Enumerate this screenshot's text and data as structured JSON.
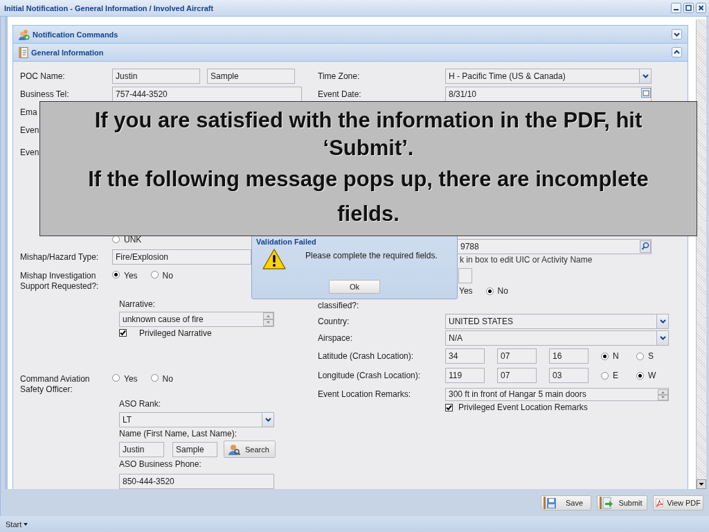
{
  "window": {
    "title": "Initial Notification - General Information / Involved Aircraft"
  },
  "sections": [
    {
      "title": "Notification Commands",
      "expanded": false
    },
    {
      "title": "General Information",
      "expanded": true
    }
  ],
  "poc": {
    "label": "POC Name:",
    "first": "Justin",
    "last": "Sample"
  },
  "business_tel": {
    "label": "Business Tel:",
    "value": "757-444-3520"
  },
  "cut_labels": [
    "Ema",
    "Even",
    "Even"
  ],
  "unk_option": {
    "label": "UNK",
    "selected": false
  },
  "hazard_type": {
    "label": "Mishap/Hazard Type:",
    "value": "Fire/Explosion"
  },
  "investigation_support": {
    "label": "Mishap Investigation Support Requested?:",
    "options": [
      {
        "label": "Yes",
        "selected": true
      },
      {
        "label": "No",
        "selected": false
      }
    ]
  },
  "narrative": {
    "label": "Narrative:",
    "value": "unknown cause of fire",
    "privileged": {
      "label": "Privileged Narrative",
      "checked": true
    }
  },
  "aso": {
    "label": "Command Aviation Safety Officer:",
    "options": [
      {
        "label": "Yes",
        "selected": false
      },
      {
        "label": "No",
        "selected": false
      }
    ],
    "rank_label": "ASO Rank:",
    "rank": "LT",
    "name_label": "Name (First Name, Last Name):",
    "first": "Justin",
    "last": "Sample",
    "search_button": "Search",
    "phone_label": "ASO Business Phone:",
    "phone": "850-444-3520"
  },
  "time_zone": {
    "label": "Time Zone:",
    "value": "H - Pacific Time (US & Canada)"
  },
  "event_date": {
    "label": "Event Date:",
    "value": "8/31/10"
  },
  "uic": {
    "value": "9788",
    "hint": "k in box to edit UIC or Activity Name"
  },
  "classified": {
    "label": "classified?:",
    "options": [
      {
        "label": "Yes"
      },
      {
        "label": "No",
        "selected": true
      }
    ]
  },
  "country": {
    "label": "Country:",
    "value": "UNITED STATES"
  },
  "airspace": {
    "label": "Airspace:",
    "value": "N/A"
  },
  "latitude": {
    "label": "Latitude (Crash Location):",
    "values": [
      "34",
      "07",
      "16"
    ],
    "options": [
      {
        "label": "N",
        "selected": true
      },
      {
        "label": "S",
        "selected": false
      }
    ]
  },
  "longitude": {
    "label": "Longitude (Crash Location):",
    "values": [
      "119",
      "07",
      "03"
    ],
    "options": [
      {
        "label": "E",
        "selected": false
      },
      {
        "label": "W",
        "selected": true
      }
    ]
  },
  "location_remarks": {
    "label": "Event Location Remarks:",
    "value": "300 ft in front of Hangar 5 main doors",
    "privileged": {
      "label": "Privileged Event Location Remarks",
      "checked": true
    }
  },
  "buttons": [
    {
      "label": "Save",
      "kind": "save"
    },
    {
      "label": "Submit",
      "kind": "submit"
    },
    {
      "label": "View PDF",
      "kind": "pdf"
    }
  ],
  "taskbar": {
    "start": "Start"
  },
  "dialog": {
    "title": "Validation Failed",
    "message": "Please complete the required fields.",
    "button": "Ok"
  },
  "caption": [
    "If you are satisfied with the information in the PDF, hit ‘Submit’.",
    "If the following message pops up, there are incomplete fields."
  ]
}
